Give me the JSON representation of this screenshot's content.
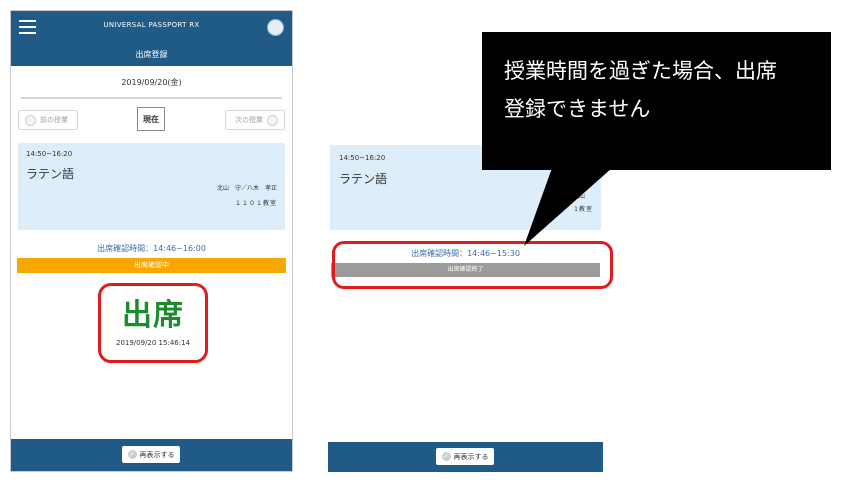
{
  "phone_left": {
    "app_title": "UNIVERSAL PASSPORT RX",
    "page_title": "出席登録",
    "date": "2019/09/20(金)",
    "nav": {
      "prev_label": "前の授業",
      "now_label": "現在",
      "next_label": "次の授業"
    },
    "class": {
      "time": "14:50~16:20",
      "subject": "ラテン語",
      "teacher": "北山　守／八木　孝正",
      "room": "１１０１教室"
    },
    "confirm_time": "出席確認時間：14:46~16:00",
    "status": "出席確認中",
    "attendance": {
      "label": "出席",
      "timestamp": "2019/09/20 15:46:14"
    },
    "reload_label": "再表示する"
  },
  "phone_right": {
    "class": {
      "time": "14:50~16:20",
      "subject": "ラテン語",
      "teacher": "北山",
      "room": "1教室"
    },
    "confirm_time": "出席確認時間：14:46~15:30",
    "status": "出席確認終了",
    "reload_label": "再表示する"
  },
  "callout": {
    "line1": "授業時間を過ぎた場合、出席",
    "line2": "登録できません"
  },
  "colors": {
    "header": "#1f5b86",
    "card": "#ddeefa",
    "status_active": "#f6a800",
    "status_ended": "#9b9b9b",
    "present": "#1c8a2e",
    "highlight": "#e11b1b"
  }
}
